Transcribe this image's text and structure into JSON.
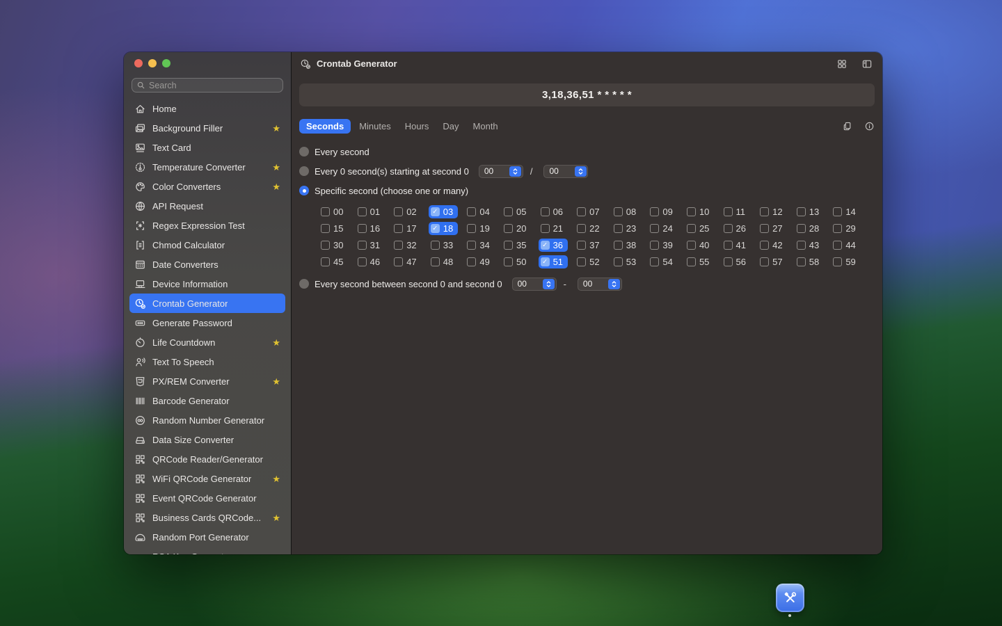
{
  "window": {
    "titlebar": {
      "title": "Crontab Generator"
    },
    "sidebar": {
      "search_placeholder": "Search",
      "items": [
        {
          "label": "Home",
          "icon": "home",
          "starred": false,
          "selected": false
        },
        {
          "label": "Background Filler",
          "icon": "photo",
          "starred": true,
          "selected": false
        },
        {
          "label": "Text Card",
          "icon": "text-card",
          "starred": false,
          "selected": false
        },
        {
          "label": "Temperature Converter",
          "icon": "thermometer",
          "starred": true,
          "selected": false
        },
        {
          "label": "Color Converters",
          "icon": "palette",
          "starred": true,
          "selected": false
        },
        {
          "label": "API Request",
          "icon": "globe",
          "starred": false,
          "selected": false
        },
        {
          "label": "Regex Expression Test",
          "icon": "regex",
          "starred": false,
          "selected": false
        },
        {
          "label": "Chmod Calculator",
          "icon": "chmod",
          "starred": false,
          "selected": false
        },
        {
          "label": "Date Converters",
          "icon": "calendar",
          "starred": false,
          "selected": false
        },
        {
          "label": "Device Information",
          "icon": "device",
          "starred": false,
          "selected": false
        },
        {
          "label": "Crontab Generator",
          "icon": "crontab",
          "starred": false,
          "selected": true
        },
        {
          "label": "Generate Password",
          "icon": "password",
          "starred": false,
          "selected": false
        },
        {
          "label": "Life Countdown",
          "icon": "countdown",
          "starred": true,
          "selected": false
        },
        {
          "label": "Text To Speech",
          "icon": "speech",
          "starred": false,
          "selected": false
        },
        {
          "label": "PX/REM Converter",
          "icon": "pxrem",
          "starred": true,
          "selected": false
        },
        {
          "label": "Barcode Generator",
          "icon": "barcode",
          "starred": false,
          "selected": false
        },
        {
          "label": "Random Number Generator",
          "icon": "random-number",
          "starred": false,
          "selected": false
        },
        {
          "label": "Data Size Converter",
          "icon": "data-size",
          "starred": false,
          "selected": false
        },
        {
          "label": "QRCode Reader/Generator",
          "icon": "qrcode",
          "starred": false,
          "selected": false
        },
        {
          "label": "WiFi QRCode Generator",
          "icon": "qrcode",
          "starred": true,
          "selected": false
        },
        {
          "label": "Event QRCode Generator",
          "icon": "qrcode",
          "starred": false,
          "selected": false
        },
        {
          "label": "Business Cards QRCode...",
          "icon": "qrcode",
          "starred": true,
          "selected": false
        },
        {
          "label": "Random Port Generator",
          "icon": "port",
          "starred": false,
          "selected": false
        },
        {
          "label": "RSA Key Generator",
          "icon": "key",
          "starred": false,
          "selected": false
        }
      ]
    },
    "main": {
      "output": "3,18,36,51 * * * * *",
      "tabs": [
        {
          "label": "Seconds",
          "selected": true
        },
        {
          "label": "Minutes",
          "selected": false
        },
        {
          "label": "Hours",
          "selected": false
        },
        {
          "label": "Day",
          "selected": false
        },
        {
          "label": "Month",
          "selected": false
        }
      ],
      "options": [
        {
          "label": "Every second",
          "selected": false
        },
        {
          "label": "Every 0 second(s) starting at second 0",
          "selected": false,
          "steppers": [
            "00",
            "00"
          ],
          "separator": "/"
        },
        {
          "label": "Specific second (choose one or many)",
          "selected": true
        },
        {
          "label": "Every second between second 0 and second 0",
          "selected": false,
          "steppers": [
            "00",
            "00"
          ],
          "separator": "-"
        }
      ],
      "seconds_grid": {
        "columns": 15,
        "values": [
          "00",
          "01",
          "02",
          "03",
          "04",
          "05",
          "06",
          "07",
          "08",
          "09",
          "10",
          "11",
          "12",
          "13",
          "14",
          "15",
          "16",
          "17",
          "18",
          "19",
          "20",
          "21",
          "22",
          "23",
          "24",
          "25",
          "26",
          "27",
          "28",
          "29",
          "30",
          "31",
          "32",
          "33",
          "34",
          "35",
          "36",
          "37",
          "38",
          "39",
          "40",
          "41",
          "42",
          "43",
          "44",
          "45",
          "46",
          "47",
          "48",
          "49",
          "50",
          "51",
          "52",
          "53",
          "54",
          "55",
          "56",
          "57",
          "58",
          "59"
        ],
        "checked": [
          "03",
          "18",
          "36",
          "51"
        ]
      }
    }
  },
  "colors": {
    "accent": "#3874f2",
    "star": "#e0c231",
    "traffic_red": "#ed6a5e",
    "traffic_yellow": "#f5bf4f",
    "traffic_green": "#61c555",
    "dock_icon_blue": "#4b7ce8"
  }
}
